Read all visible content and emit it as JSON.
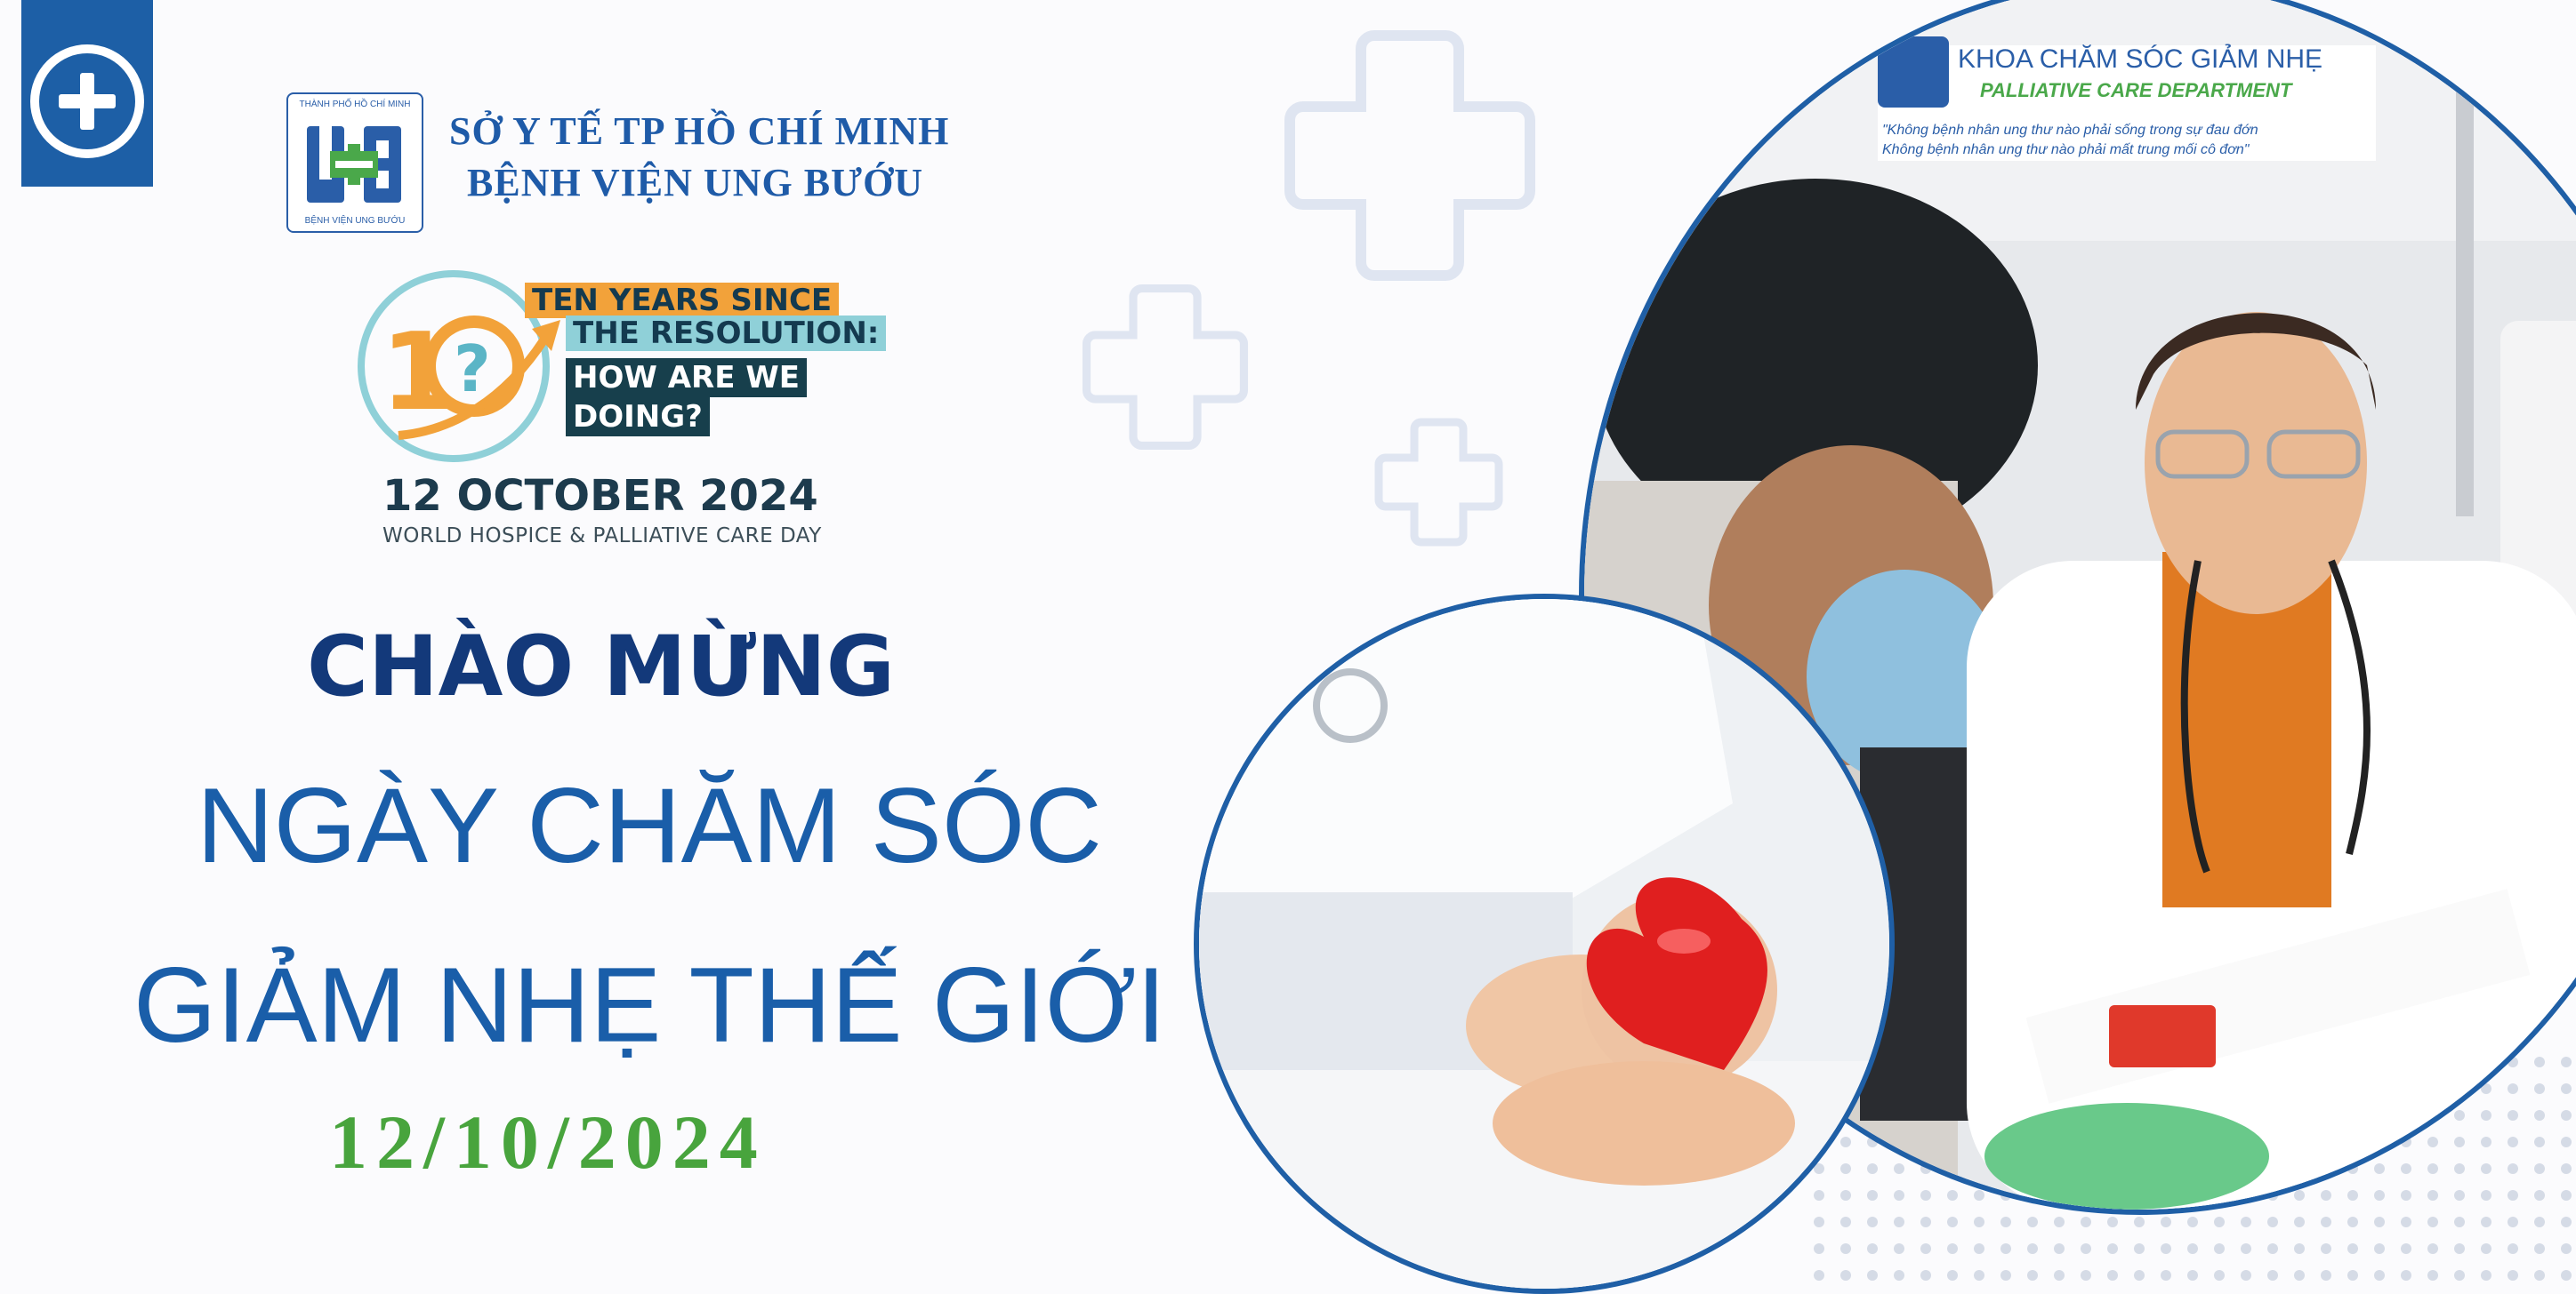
{
  "header": {
    "corner_icon": "plus-icon",
    "org_line1": "SỞ Y TẾ TP HỒ CHÍ MINH",
    "org_line2": "BỆNH VIỆN UNG BƯỚU",
    "logo_top": "THÀNH PHỐ HỒ CHÍ MINH",
    "logo_bottom": "BỆNH VIỆN UNG BƯỚU"
  },
  "campaign": {
    "line1": "TEN YEARS SINCE",
    "line2": "THE RESOLUTION:",
    "line3": "HOW ARE WE",
    "line4": "DOING?",
    "date": "12 OCTOBER 2024",
    "event": "WORLD HOSPICE & PALLIATIVE CARE DAY"
  },
  "headline": {
    "welcome": "CHÀO MỪNG",
    "line1": "NGÀY CHĂM SÓC",
    "line2": "GIẢM NHẸ THẾ GIỚI",
    "date": "12/10/2024"
  },
  "photo_sign": {
    "title": "KHOA CHĂM SÓC GIẢM NHẸ",
    "subtitle": "PALLIATIVE CARE DEPARTMENT",
    "quote1": "\"Không bệnh nhân ung thư nào phải sống trong sự đau đớn",
    "quote2": "Không bệnh nhân ung thư nào phải mất trung mối cô đơn\""
  },
  "colors": {
    "primary_blue": "#1a5ea9",
    "dark_blue": "#13397a",
    "green": "#48a43d",
    "orange": "#f2a23a",
    "teal": "#8fd0d8"
  }
}
